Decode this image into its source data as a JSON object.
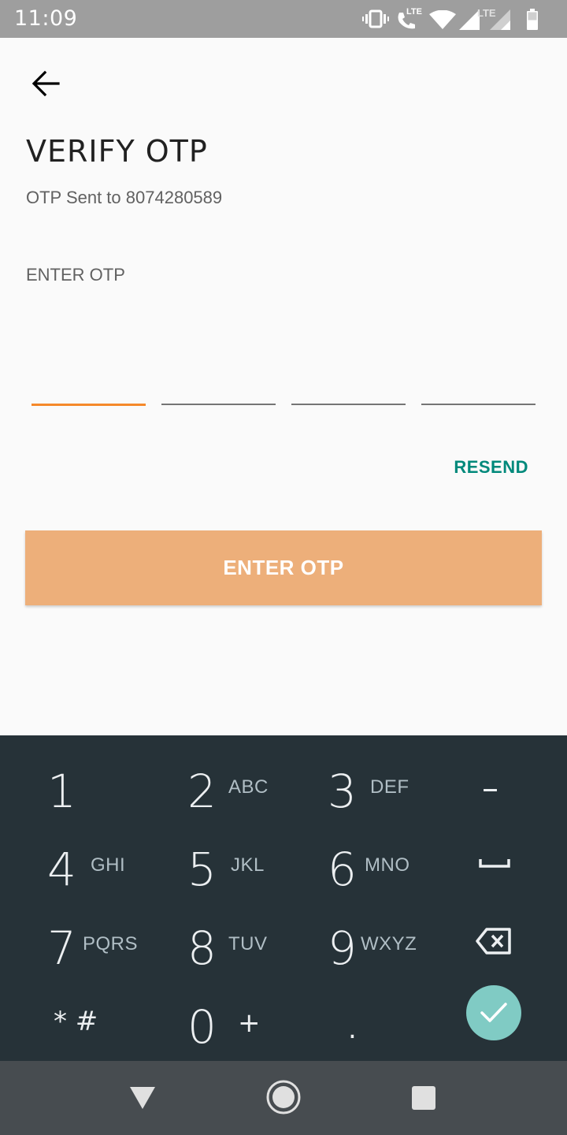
{
  "status_bar": {
    "time": "11:09",
    "lte_call": "LTE",
    "lte_signal": "LTE",
    "icons": [
      "vibrate-icon",
      "call-lte-icon",
      "wifi-icon",
      "signal-icon",
      "signal-lte-icon",
      "battery-icon"
    ]
  },
  "header": {
    "back_icon": "arrow-back-icon",
    "title": "VERIFY OTP",
    "subtitle_prefix": "OTP Sent to",
    "phone": "8074280589"
  },
  "otp": {
    "label": "ENTER OTP",
    "digits": [
      "",
      "",
      "",
      ""
    ],
    "active_index": 0,
    "active_color": "#f5892a",
    "resend_label": "RESEND",
    "resend_color": "#00897b"
  },
  "submit": {
    "label": "ENTER OTP",
    "color": "#edaf7a"
  },
  "keyboard": {
    "keys": [
      {
        "digit": "1",
        "letters": ""
      },
      {
        "digit": "2",
        "letters": "ABC"
      },
      {
        "digit": "3",
        "letters": "DEF"
      },
      {
        "digit": "4",
        "letters": "GHI"
      },
      {
        "digit": "5",
        "letters": "JKL"
      },
      {
        "digit": "6",
        "letters": "MNO"
      },
      {
        "digit": "7",
        "letters": "PQRS"
      },
      {
        "digit": "8",
        "letters": "TUV"
      },
      {
        "digit": "9",
        "letters": "WXYZ"
      },
      {
        "digit": "0",
        "letters": "+"
      }
    ],
    "star_hash": "* #",
    "period": ".",
    "minus": "–",
    "space_icon": "space-icon",
    "backspace_icon": "backspace-icon",
    "done_icon": "check-icon",
    "done_color": "#80cbc4"
  },
  "nav_bar": {
    "icons": [
      "back-triangle-icon",
      "home-circle-icon",
      "recents-square-icon"
    ]
  }
}
